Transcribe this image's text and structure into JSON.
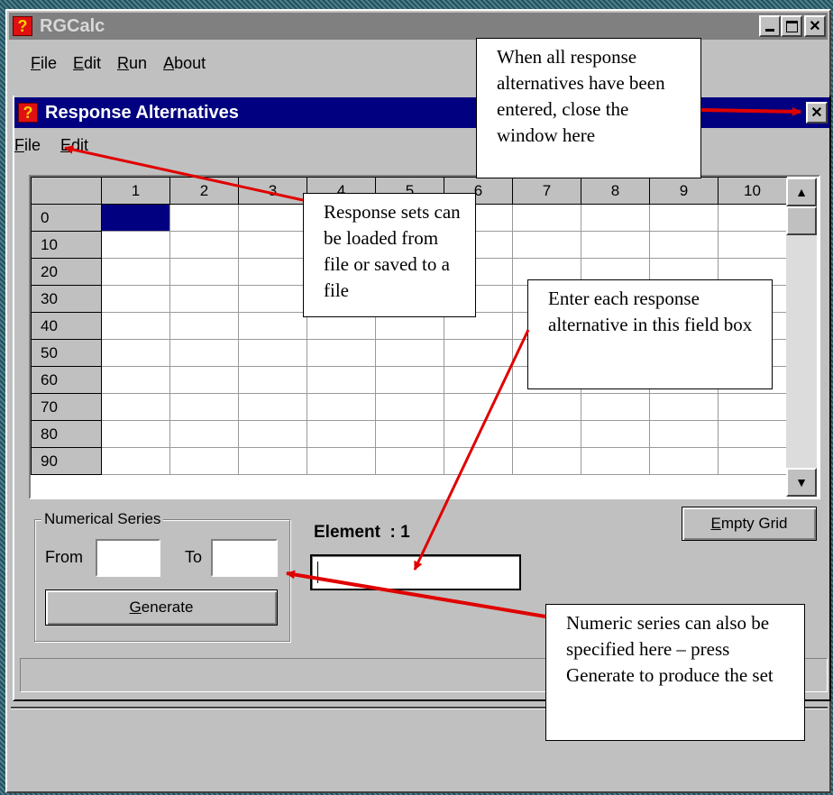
{
  "app": {
    "title": "RGCalc",
    "menu": [
      "File",
      "Edit",
      "Run",
      "About"
    ]
  },
  "dialog": {
    "title": "Response Alternatives",
    "menu": [
      "File",
      "Edit"
    ],
    "grid": {
      "col_headers": [
        "1",
        "2",
        "3",
        "4",
        "5",
        "6",
        "7",
        "8",
        "9",
        "10"
      ],
      "row_headers": [
        "0",
        "10",
        "20",
        "30",
        "40",
        "50",
        "60",
        "70",
        "80",
        "90"
      ],
      "selected_cell": "0/1"
    },
    "numerical_series": {
      "legend": "Numerical Series",
      "from_label": "From",
      "to_label": "To",
      "from_value": "",
      "to_value": "",
      "generate_label": "Generate"
    },
    "element_label": "Element  : 1",
    "element_value": "",
    "empty_grid_label": "Empty Grid"
  },
  "callouts": {
    "close": "When all response alternatives  have been entered, close the window here",
    "file": "Response sets can be loaded from file or saved to a file",
    "enter": "Enter each response alternative in this field box",
    "numeric": "Numeric series can also be specified here – press Generate to produce the set"
  },
  "colors": {
    "titlebar_active": "#000080",
    "titlebar_inactive": "#808080",
    "window_face": "#c0c0c0",
    "arrow": "#e00000",
    "selection": "#000080"
  },
  "icons": [
    "app-icon",
    "minimize-icon",
    "maximize-icon",
    "close-icon",
    "scroll-up-icon",
    "scroll-down-icon"
  ]
}
